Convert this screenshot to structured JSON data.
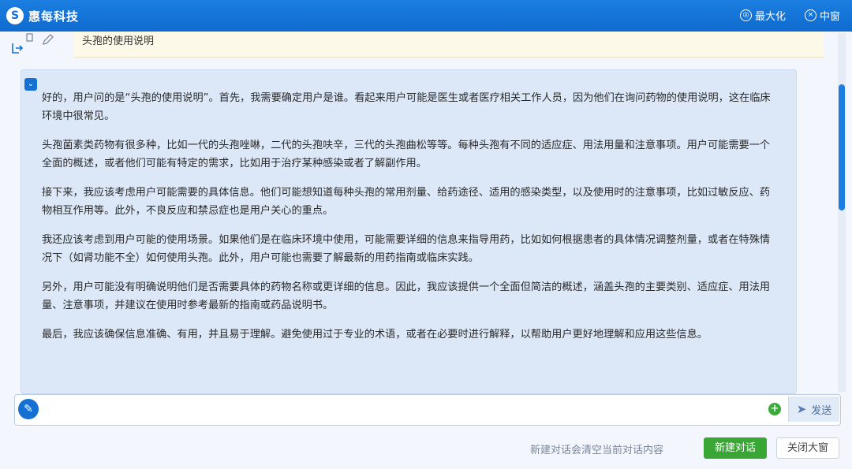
{
  "titlebar": {
    "brand": "惠每科技",
    "maximize_label": "最大化",
    "medium_label": "中窗"
  },
  "question": {
    "text": "头孢的使用说明"
  },
  "answer": {
    "paragraphs": [
      "好的，用户问的是“头孢的使用说明”。首先，我需要确定用户是谁。看起来用户可能是医生或者医疗相关工作人员，因为他们在询问药物的使用说明，这在临床环境中很常见。",
      "头孢菌素类药物有很多种，比如一代的头孢唑啉，二代的头孢呋辛，三代的头孢曲松等等。每种头孢有不同的适应症、用法用量和注意事项。用户可能需要一个全面的概述，或者他们可能有特定的需求，比如用于治疗某种感染或者了解副作用。",
      "接下来，我应该考虑用户可能需要的具体信息。他们可能想知道每种头孢的常用剂量、给药途径、适用的感染类型，以及使用时的注意事项，比如过敏反应、药物相互作用等。此外，不良反应和禁忌症也是用户关心的重点。",
      "我还应该考虑到用户可能的使用场景。如果他们是在临床环境中使用，可能需要详细的信息来指导用药，比如如何根据患者的具体情况调整剂量，或者在特殊情况下（如肾功能不全）如何使用头孢。此外，用户可能也需要了解最新的用药指南或临床实践。",
      "另外，用户可能没有明确说明他们是否需要具体的药物名称或更详细的信息。因此，我应该提供一个全面但简洁的概述，涵盖头孢的主要类别、适应症、用法用量、注意事项，并建议在使用时参考最新的指南或药品说明书。",
      "最后，我应该确保信息准确、有用，并且易于理解。避免使用过于专业的术语，或者在必要时进行解释，以帮助用户更好地理解和应用这些信息。"
    ]
  },
  "input": {
    "value": "",
    "send_label": "发送"
  },
  "footer": {
    "hint": "新建对话会清空当前对话内容",
    "new_chat_label": "新建对话",
    "close_label": "关闭大窗"
  }
}
